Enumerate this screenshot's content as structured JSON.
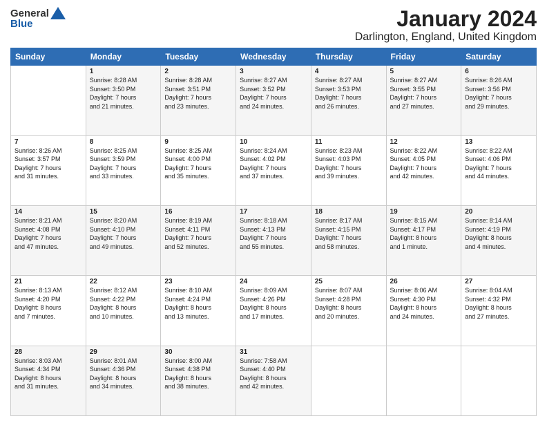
{
  "header": {
    "logo_general": "General",
    "logo_blue": "Blue",
    "month_title": "January 2024",
    "location": "Darlington, England, United Kingdom"
  },
  "days": [
    "Sunday",
    "Monday",
    "Tuesday",
    "Wednesday",
    "Thursday",
    "Friday",
    "Saturday"
  ],
  "weeks": [
    [
      {
        "num": "",
        "content": ""
      },
      {
        "num": "1",
        "content": "Sunrise: 8:28 AM\nSunset: 3:50 PM\nDaylight: 7 hours\nand 21 minutes."
      },
      {
        "num": "2",
        "content": "Sunrise: 8:28 AM\nSunset: 3:51 PM\nDaylight: 7 hours\nand 23 minutes."
      },
      {
        "num": "3",
        "content": "Sunrise: 8:27 AM\nSunset: 3:52 PM\nDaylight: 7 hours\nand 24 minutes."
      },
      {
        "num": "4",
        "content": "Sunrise: 8:27 AM\nSunset: 3:53 PM\nDaylight: 7 hours\nand 26 minutes."
      },
      {
        "num": "5",
        "content": "Sunrise: 8:27 AM\nSunset: 3:55 PM\nDaylight: 7 hours\nand 27 minutes."
      },
      {
        "num": "6",
        "content": "Sunrise: 8:26 AM\nSunset: 3:56 PM\nDaylight: 7 hours\nand 29 minutes."
      }
    ],
    [
      {
        "num": "7",
        "content": "Sunrise: 8:26 AM\nSunset: 3:57 PM\nDaylight: 7 hours\nand 31 minutes."
      },
      {
        "num": "8",
        "content": "Sunrise: 8:25 AM\nSunset: 3:59 PM\nDaylight: 7 hours\nand 33 minutes."
      },
      {
        "num": "9",
        "content": "Sunrise: 8:25 AM\nSunset: 4:00 PM\nDaylight: 7 hours\nand 35 minutes."
      },
      {
        "num": "10",
        "content": "Sunrise: 8:24 AM\nSunset: 4:02 PM\nDaylight: 7 hours\nand 37 minutes."
      },
      {
        "num": "11",
        "content": "Sunrise: 8:23 AM\nSunset: 4:03 PM\nDaylight: 7 hours\nand 39 minutes."
      },
      {
        "num": "12",
        "content": "Sunrise: 8:22 AM\nSunset: 4:05 PM\nDaylight: 7 hours\nand 42 minutes."
      },
      {
        "num": "13",
        "content": "Sunrise: 8:22 AM\nSunset: 4:06 PM\nDaylight: 7 hours\nand 44 minutes."
      }
    ],
    [
      {
        "num": "14",
        "content": "Sunrise: 8:21 AM\nSunset: 4:08 PM\nDaylight: 7 hours\nand 47 minutes."
      },
      {
        "num": "15",
        "content": "Sunrise: 8:20 AM\nSunset: 4:10 PM\nDaylight: 7 hours\nand 49 minutes."
      },
      {
        "num": "16",
        "content": "Sunrise: 8:19 AM\nSunset: 4:11 PM\nDaylight: 7 hours\nand 52 minutes."
      },
      {
        "num": "17",
        "content": "Sunrise: 8:18 AM\nSunset: 4:13 PM\nDaylight: 7 hours\nand 55 minutes."
      },
      {
        "num": "18",
        "content": "Sunrise: 8:17 AM\nSunset: 4:15 PM\nDaylight: 7 hours\nand 58 minutes."
      },
      {
        "num": "19",
        "content": "Sunrise: 8:15 AM\nSunset: 4:17 PM\nDaylight: 8 hours\nand 1 minute."
      },
      {
        "num": "20",
        "content": "Sunrise: 8:14 AM\nSunset: 4:19 PM\nDaylight: 8 hours\nand 4 minutes."
      }
    ],
    [
      {
        "num": "21",
        "content": "Sunrise: 8:13 AM\nSunset: 4:20 PM\nDaylight: 8 hours\nand 7 minutes."
      },
      {
        "num": "22",
        "content": "Sunrise: 8:12 AM\nSunset: 4:22 PM\nDaylight: 8 hours\nand 10 minutes."
      },
      {
        "num": "23",
        "content": "Sunrise: 8:10 AM\nSunset: 4:24 PM\nDaylight: 8 hours\nand 13 minutes."
      },
      {
        "num": "24",
        "content": "Sunrise: 8:09 AM\nSunset: 4:26 PM\nDaylight: 8 hours\nand 17 minutes."
      },
      {
        "num": "25",
        "content": "Sunrise: 8:07 AM\nSunset: 4:28 PM\nDaylight: 8 hours\nand 20 minutes."
      },
      {
        "num": "26",
        "content": "Sunrise: 8:06 AM\nSunset: 4:30 PM\nDaylight: 8 hours\nand 24 minutes."
      },
      {
        "num": "27",
        "content": "Sunrise: 8:04 AM\nSunset: 4:32 PM\nDaylight: 8 hours\nand 27 minutes."
      }
    ],
    [
      {
        "num": "28",
        "content": "Sunrise: 8:03 AM\nSunset: 4:34 PM\nDaylight: 8 hours\nand 31 minutes."
      },
      {
        "num": "29",
        "content": "Sunrise: 8:01 AM\nSunset: 4:36 PM\nDaylight: 8 hours\nand 34 minutes."
      },
      {
        "num": "30",
        "content": "Sunrise: 8:00 AM\nSunset: 4:38 PM\nDaylight: 8 hours\nand 38 minutes."
      },
      {
        "num": "31",
        "content": "Sunrise: 7:58 AM\nSunset: 4:40 PM\nDaylight: 8 hours\nand 42 minutes."
      },
      {
        "num": "",
        "content": ""
      },
      {
        "num": "",
        "content": ""
      },
      {
        "num": "",
        "content": ""
      }
    ]
  ]
}
